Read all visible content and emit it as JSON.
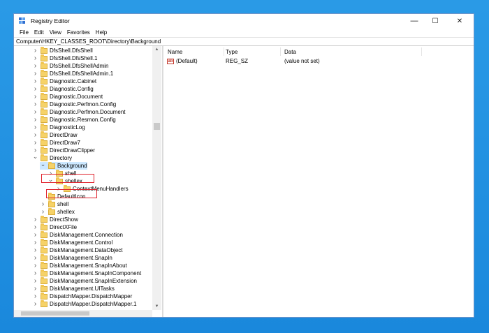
{
  "window": {
    "title": "Registry Editor",
    "minimize": "—",
    "maximize": "☐",
    "close": "✕"
  },
  "menu": [
    "File",
    "Edit",
    "View",
    "Favorites",
    "Help"
  ],
  "address": "Computer\\HKEY_CLASSES_ROOT\\Directory\\Background",
  "tree": [
    {
      "label": "DfsShell.DfsShell",
      "level": 0,
      "expander": ">"
    },
    {
      "label": "DfsShell.DfsShell.1",
      "level": 0,
      "expander": ">"
    },
    {
      "label": "DfsShell.DfsShellAdmin",
      "level": 0,
      "expander": ">"
    },
    {
      "label": "DfsShell.DfsShellAdmin.1",
      "level": 0,
      "expander": ">"
    },
    {
      "label": "Diagnostic.Cabinet",
      "level": 0,
      "expander": ">"
    },
    {
      "label": "Diagnostic.Config",
      "level": 0,
      "expander": ">"
    },
    {
      "label": "Diagnostic.Document",
      "level": 0,
      "expander": ">"
    },
    {
      "label": "Diagnostic.Perfmon.Config",
      "level": 0,
      "expander": ">"
    },
    {
      "label": "Diagnostic.Perfmon.Document",
      "level": 0,
      "expander": ">"
    },
    {
      "label": "Diagnostic.Resmon.Config",
      "level": 0,
      "expander": ">"
    },
    {
      "label": "DiagnosticLog",
      "level": 0,
      "expander": ">"
    },
    {
      "label": "DirectDraw",
      "level": 0,
      "expander": ">"
    },
    {
      "label": "DirectDraw7",
      "level": 0,
      "expander": ">"
    },
    {
      "label": "DirectDrawClipper",
      "level": 0,
      "expander": ">"
    },
    {
      "label": "Directory",
      "level": 0,
      "expander": "v"
    },
    {
      "label": "Background",
      "level": 1,
      "expander": "v",
      "selected": true
    },
    {
      "label": "shell",
      "level": 2,
      "expander": ">"
    },
    {
      "label": "shellex",
      "level": 2,
      "expander": "v"
    },
    {
      "label": "ContextMenuHandlers",
      "level": 3,
      "expander": ">"
    },
    {
      "label": "DefaultIcon",
      "level": 1,
      "expander": ""
    },
    {
      "label": "shell",
      "level": 1,
      "expander": ">"
    },
    {
      "label": "shellex",
      "level": 1,
      "expander": ">"
    },
    {
      "label": "DirectShow",
      "level": 0,
      "expander": ">"
    },
    {
      "label": "DirectXFile",
      "level": 0,
      "expander": ">"
    },
    {
      "label": "DiskManagement.Connection",
      "level": 0,
      "expander": ">"
    },
    {
      "label": "DiskManagement.Control",
      "level": 0,
      "expander": ">"
    },
    {
      "label": "DiskManagement.DataObject",
      "level": 0,
      "expander": ">"
    },
    {
      "label": "DiskManagement.SnapIn",
      "level": 0,
      "expander": ">"
    },
    {
      "label": "DiskManagement.SnapInAbout",
      "level": 0,
      "expander": ">"
    },
    {
      "label": "DiskManagement.SnapInComponent",
      "level": 0,
      "expander": ">"
    },
    {
      "label": "DiskManagement.SnapInExtension",
      "level": 0,
      "expander": ">"
    },
    {
      "label": "DiskManagement.UITasks",
      "level": 0,
      "expander": ">"
    },
    {
      "label": "DispatchMapper.DispatchMapper",
      "level": 0,
      "expander": ">"
    },
    {
      "label": "DispatchMapper.DispatchMapper.1",
      "level": 0,
      "expander": ">"
    }
  ],
  "columns": [
    "Name",
    "Type",
    "Data"
  ],
  "values": [
    {
      "name": "(Default)",
      "type": "REG_SZ",
      "data": "(value not set)",
      "icon": "ab"
    }
  ],
  "colors": {
    "selection": "#cce8ff",
    "highlight_box": "#e0222d",
    "desktop": "#1f8fe0"
  }
}
